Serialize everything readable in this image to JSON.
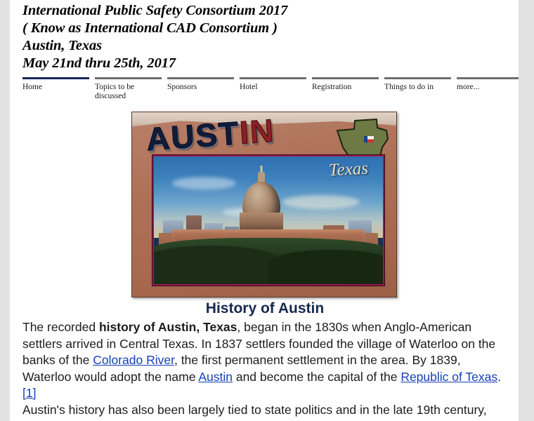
{
  "header": {
    "lines": [
      "International  Public Safety Consortium 2017",
      "( Know as International CAD Consortium )",
      "Austin, Texas",
      "May 21nd thru 25th, 2017"
    ]
  },
  "nav": {
    "items": [
      {
        "label": "Home",
        "active": true
      },
      {
        "label": "Topics to be discussed",
        "active": false
      },
      {
        "label": "Sponsors",
        "active": false
      },
      {
        "label": "Hotel",
        "active": false
      },
      {
        "label": "Registration",
        "active": false
      },
      {
        "label": "Things to do in",
        "active": false
      },
      {
        "label": "more...",
        "active": false
      }
    ],
    "active_border_color": "#15285a",
    "inactive_border_color": "#6e6e6e"
  },
  "hero": {
    "alt": "Austin Texas postcard with State Capitol",
    "title_word_blue": "AUST",
    "title_word_red": "IN",
    "script_word": "Texas"
  },
  "article": {
    "heading": "History of Austin",
    "heading_color": "#16294d",
    "p1": {
      "t1": "The recorded ",
      "b1": "history of Austin, Texas",
      "t2": ", began in the 1830s when Anglo-American settlers arrived in Central Texas. In 1837 settlers founded the village of Waterloo on the banks of the ",
      "link1": "Colorado River",
      "t3": ", the first permanent settlement in the area. By 1839, Waterloo would adopt the name ",
      "link2": "Austin",
      "t4": " and become the capital of the ",
      "link3": "Republic of Texas",
      "t5": ".",
      "ref1": "[1]"
    },
    "p2": "Austin's history has also been largely tied to state politics and in the late 19th century,",
    "link_color": "#1541b4"
  }
}
